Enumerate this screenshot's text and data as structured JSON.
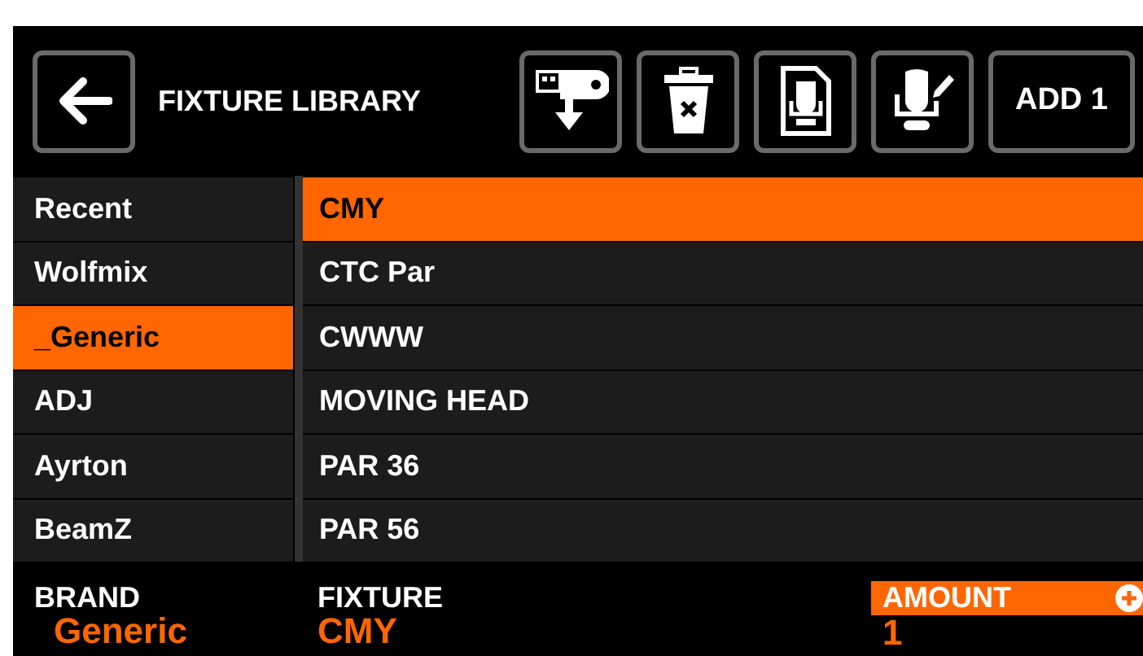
{
  "header": {
    "title": "FIXTURE LIBRARY",
    "add_button": "ADD 1"
  },
  "brands": [
    {
      "label": "Recent",
      "selected": false
    },
    {
      "label": "Wolfmix",
      "selected": false
    },
    {
      "label": "_Generic",
      "selected": true
    },
    {
      "label": "ADJ",
      "selected": false
    },
    {
      "label": "Ayrton",
      "selected": false
    },
    {
      "label": "BeamZ",
      "selected": false
    }
  ],
  "fixtures": [
    {
      "label": "CMY",
      "selected": true
    },
    {
      "label": "CTC Par",
      "selected": false
    },
    {
      "label": "CWWW",
      "selected": false
    },
    {
      "label": "MOVING HEAD",
      "selected": false
    },
    {
      "label": "PAR 36",
      "selected": false
    },
    {
      "label": "PAR 56",
      "selected": false
    }
  ],
  "footer": {
    "brand_label": "BRAND",
    "brand_value": "Generic",
    "fixture_label": "FIXTURE",
    "fixture_value": "CMY",
    "amount_label": "AMOUNT",
    "amount_value": "1"
  }
}
